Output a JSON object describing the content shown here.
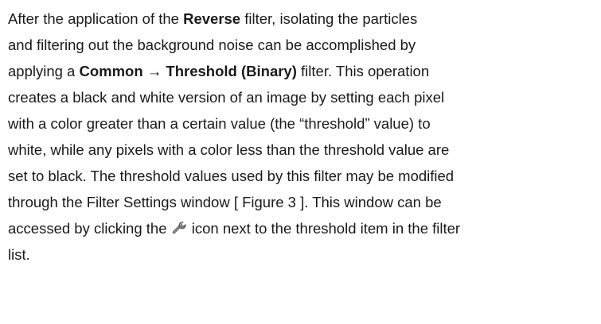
{
  "paragraph": {
    "l1_a": "After the application of the ",
    "l1_b": "Reverse",
    "l1_c": " filter, isolating the particles",
    "l2": "and filtering out the background noise can be accomplished by",
    "l3_a": "applying a ",
    "l3_b": "Common → Threshold (Binary)",
    "l3_c": " filter. This operation",
    "l4": "creates a black and white version of an image by setting each pixel",
    "l5": "with a color greater than a certain value (the “threshold” value) to",
    "l6": "white, while any pixels with a color less than the threshold value are",
    "l7": "set to black. The threshold values used by this filter may be modified",
    "l8": "through the Filter Settings window [ Figure 3 ]. This window can be",
    "l9_a": "accessed by clicking the ",
    "l9_icon": "wrench-icon",
    "l9_b": " icon next to the threshold item in the filter",
    "l10": "list."
  }
}
